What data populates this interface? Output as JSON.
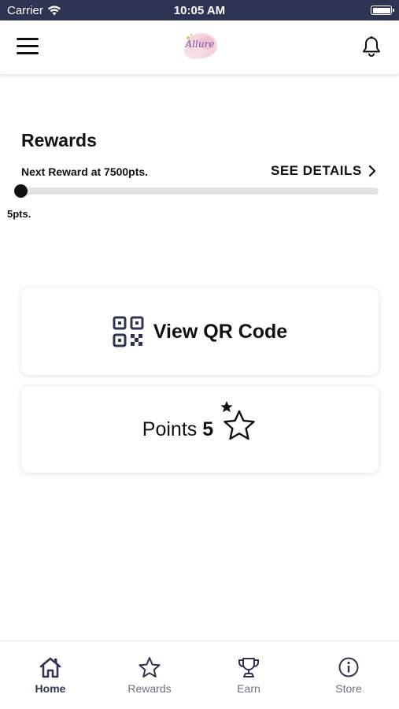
{
  "status_bar": {
    "carrier": "Carrier",
    "time": "10:05 AM",
    "signal_icon": "wifi-icon",
    "battery_icon": "battery-icon"
  },
  "header": {
    "menu_icon": "hamburger-menu-icon",
    "logo_text": "Allure",
    "notification_icon": "bell-icon"
  },
  "rewards": {
    "title": "Rewards",
    "next_reward": "Next Reward at 7500pts.",
    "see_details": "SEE DETAILS",
    "current_points_label": "5pts.",
    "progress_fraction": 0.0007
  },
  "qr_card": {
    "label": "View QR Code",
    "icon": "qr-code-icon"
  },
  "points_card": {
    "label": "Points",
    "value": "5",
    "icon": "star-icon"
  },
  "tab_bar": {
    "tabs": [
      {
        "label": "Home",
        "icon": "home-icon",
        "active": true
      },
      {
        "label": "Rewards",
        "icon": "star-icon",
        "active": false
      },
      {
        "label": "Earn",
        "icon": "trophy-icon",
        "active": false
      },
      {
        "label": "Store",
        "icon": "info-icon",
        "active": false
      }
    ]
  },
  "colors": {
    "status_bar_bg": "#2e3552",
    "accent_dark": "#2e3552",
    "progress_track": "#e3e3e3",
    "text_primary": "#111111",
    "tab_inactive": "#6b6f7e"
  }
}
